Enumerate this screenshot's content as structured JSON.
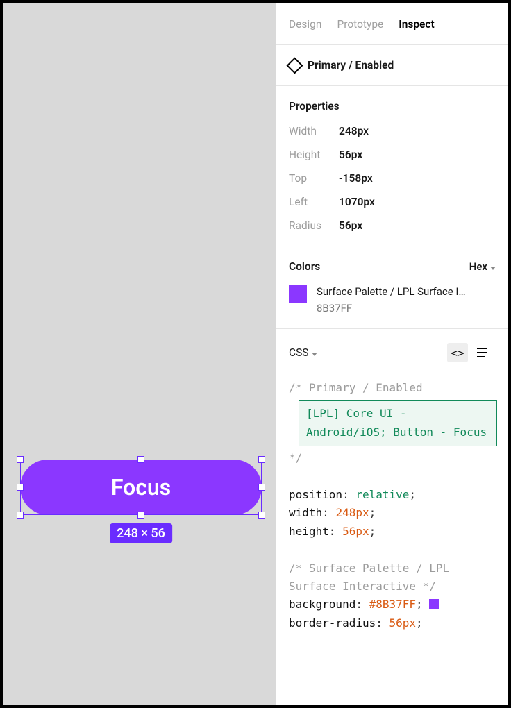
{
  "canvas": {
    "element": {
      "label": "Focus",
      "fill": "#8B37FF",
      "dimensions": "248 × 56"
    }
  },
  "tabs": {
    "design": "Design",
    "prototype": "Prototype",
    "inspect": "Inspect",
    "active": "Inspect"
  },
  "layer": {
    "name": "Primary / Enabled"
  },
  "properties": {
    "title": "Properties",
    "rows": {
      "width": {
        "label": "Width",
        "value": "248px"
      },
      "height": {
        "label": "Height",
        "value": "56px"
      },
      "top": {
        "label": "Top",
        "value": "-158px"
      },
      "left": {
        "label": "Left",
        "value": "1070px"
      },
      "radius": {
        "label": "Radius",
        "value": "56px"
      }
    }
  },
  "colors": {
    "title": "Colors",
    "format": "Hex",
    "item": {
      "name": "Surface Palette / LPL Surface I…",
      "hex": "8B37FF",
      "swatch": "#8B37FF"
    }
  },
  "css": {
    "lang": "CSS",
    "comment_open": "/* Primary / Enabled",
    "callout": "[LPL] Core UI - Android/iOS; Button - Focus",
    "comment_close": "*/",
    "position_k": "position",
    "position_v": "relative",
    "width_k": "width",
    "width_v": "248px",
    "height_k": "height",
    "height_v": "56px",
    "comment_surface": "/* Surface Palette / LPL Surface Interactive */",
    "background_k": "background",
    "background_v": "#8B37FF",
    "radius_k": "border-radius",
    "radius_v": "56px",
    "inline_swatch": "#8B37FF"
  }
}
